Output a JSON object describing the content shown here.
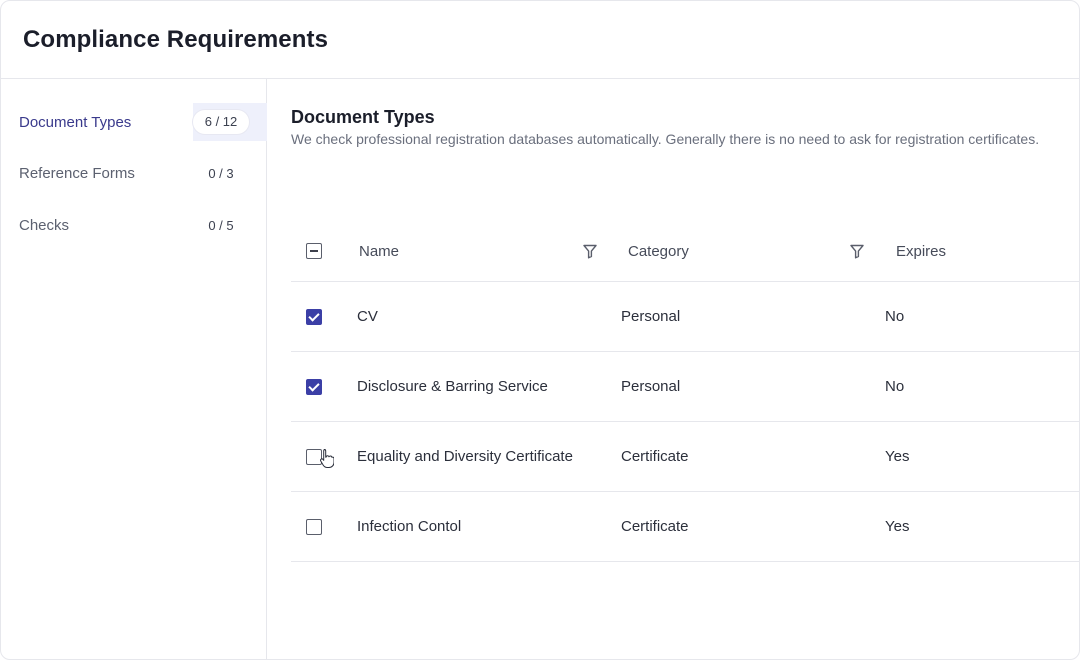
{
  "header": {
    "title": "Compliance Requirements"
  },
  "sidebar": {
    "items": [
      {
        "label": "Document Types",
        "count": "6 / 12",
        "active": true
      },
      {
        "label": "Reference Forms",
        "count": "0 / 3",
        "active": false
      },
      {
        "label": "Checks",
        "count": "0 / 5",
        "active": false
      }
    ]
  },
  "main": {
    "title": "Document Types",
    "description": "We check professional registration databases automatically. Generally there is no need to ask for registration certificates.",
    "table": {
      "columns": [
        "Name",
        "Category",
        "Expires"
      ],
      "select_all_state": "indeterminate",
      "rows": [
        {
          "name": "CV",
          "category": "Personal",
          "expires": "No",
          "checked": true
        },
        {
          "name": "Disclosure & Barring Service",
          "category": "Personal",
          "expires": "No",
          "checked": true
        },
        {
          "name": "Equality and Diversity Certificate",
          "category": "Certificate",
          "expires": "Yes",
          "checked": false
        },
        {
          "name": "Infection Contol",
          "category": "Certificate",
          "expires": "Yes",
          "checked": false
        }
      ]
    }
  },
  "icons": {
    "filter": "filter-icon",
    "cursor": "hand-pointer-cursor-icon"
  },
  "colors": {
    "accent": "#3b3fa6",
    "active_nav_text": "#3a3a8c",
    "active_nav_bg": "#eef0fb"
  }
}
